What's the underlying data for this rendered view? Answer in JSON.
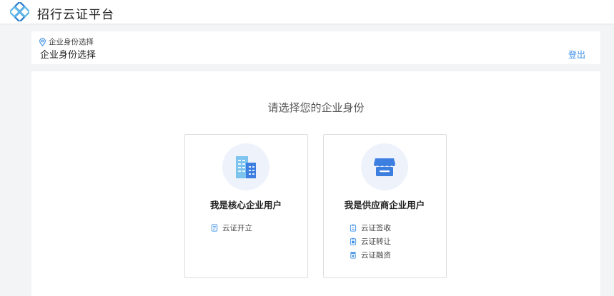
{
  "app": {
    "title": "招行云证平台",
    "logo_icon": "diamond-chain-logo",
    "accent": "#3a8ee6"
  },
  "breadcrumb": {
    "icon": "location-pin-icon",
    "item": "企业身份选择",
    "page_title": "企业身份选择",
    "logout_label": "登出"
  },
  "main": {
    "prompt": "请选择您的企业身份",
    "cards": [
      {
        "title": "我是核心企业用户",
        "icon": "buildings-icon",
        "features": [
          {
            "label": "云证开立",
            "icon": "document-icon"
          }
        ]
      },
      {
        "title": "我是供应商企业用户",
        "icon": "storefront-icon",
        "features": [
          {
            "label": "云证签收",
            "icon": "clipboard-check-icon"
          },
          {
            "label": "云证转让",
            "icon": "clipboard-transfer-icon"
          },
          {
            "label": "云证融资",
            "icon": "finance-box-icon"
          }
        ]
      }
    ]
  }
}
